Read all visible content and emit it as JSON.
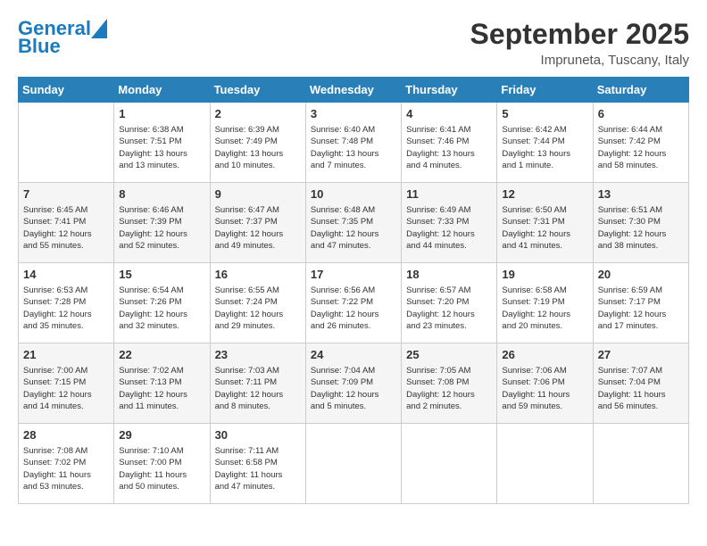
{
  "header": {
    "logo_line1": "General",
    "logo_line2": "Blue",
    "month_title": "September 2025",
    "subtitle": "Impruneta, Tuscany, Italy"
  },
  "days_of_week": [
    "Sunday",
    "Monday",
    "Tuesday",
    "Wednesday",
    "Thursday",
    "Friday",
    "Saturday"
  ],
  "weeks": [
    [
      {
        "day": "",
        "content": ""
      },
      {
        "day": "1",
        "content": "Sunrise: 6:38 AM\nSunset: 7:51 PM\nDaylight: 13 hours\nand 13 minutes."
      },
      {
        "day": "2",
        "content": "Sunrise: 6:39 AM\nSunset: 7:49 PM\nDaylight: 13 hours\nand 10 minutes."
      },
      {
        "day": "3",
        "content": "Sunrise: 6:40 AM\nSunset: 7:48 PM\nDaylight: 13 hours\nand 7 minutes."
      },
      {
        "day": "4",
        "content": "Sunrise: 6:41 AM\nSunset: 7:46 PM\nDaylight: 13 hours\nand 4 minutes."
      },
      {
        "day": "5",
        "content": "Sunrise: 6:42 AM\nSunset: 7:44 PM\nDaylight: 13 hours\nand 1 minute."
      },
      {
        "day": "6",
        "content": "Sunrise: 6:44 AM\nSunset: 7:42 PM\nDaylight: 12 hours\nand 58 minutes."
      }
    ],
    [
      {
        "day": "7",
        "content": "Sunrise: 6:45 AM\nSunset: 7:41 PM\nDaylight: 12 hours\nand 55 minutes."
      },
      {
        "day": "8",
        "content": "Sunrise: 6:46 AM\nSunset: 7:39 PM\nDaylight: 12 hours\nand 52 minutes."
      },
      {
        "day": "9",
        "content": "Sunrise: 6:47 AM\nSunset: 7:37 PM\nDaylight: 12 hours\nand 49 minutes."
      },
      {
        "day": "10",
        "content": "Sunrise: 6:48 AM\nSunset: 7:35 PM\nDaylight: 12 hours\nand 47 minutes."
      },
      {
        "day": "11",
        "content": "Sunrise: 6:49 AM\nSunset: 7:33 PM\nDaylight: 12 hours\nand 44 minutes."
      },
      {
        "day": "12",
        "content": "Sunrise: 6:50 AM\nSunset: 7:31 PM\nDaylight: 12 hours\nand 41 minutes."
      },
      {
        "day": "13",
        "content": "Sunrise: 6:51 AM\nSunset: 7:30 PM\nDaylight: 12 hours\nand 38 minutes."
      }
    ],
    [
      {
        "day": "14",
        "content": "Sunrise: 6:53 AM\nSunset: 7:28 PM\nDaylight: 12 hours\nand 35 minutes."
      },
      {
        "day": "15",
        "content": "Sunrise: 6:54 AM\nSunset: 7:26 PM\nDaylight: 12 hours\nand 32 minutes."
      },
      {
        "day": "16",
        "content": "Sunrise: 6:55 AM\nSunset: 7:24 PM\nDaylight: 12 hours\nand 29 minutes."
      },
      {
        "day": "17",
        "content": "Sunrise: 6:56 AM\nSunset: 7:22 PM\nDaylight: 12 hours\nand 26 minutes."
      },
      {
        "day": "18",
        "content": "Sunrise: 6:57 AM\nSunset: 7:20 PM\nDaylight: 12 hours\nand 23 minutes."
      },
      {
        "day": "19",
        "content": "Sunrise: 6:58 AM\nSunset: 7:19 PM\nDaylight: 12 hours\nand 20 minutes."
      },
      {
        "day": "20",
        "content": "Sunrise: 6:59 AM\nSunset: 7:17 PM\nDaylight: 12 hours\nand 17 minutes."
      }
    ],
    [
      {
        "day": "21",
        "content": "Sunrise: 7:00 AM\nSunset: 7:15 PM\nDaylight: 12 hours\nand 14 minutes."
      },
      {
        "day": "22",
        "content": "Sunrise: 7:02 AM\nSunset: 7:13 PM\nDaylight: 12 hours\nand 11 minutes."
      },
      {
        "day": "23",
        "content": "Sunrise: 7:03 AM\nSunset: 7:11 PM\nDaylight: 12 hours\nand 8 minutes."
      },
      {
        "day": "24",
        "content": "Sunrise: 7:04 AM\nSunset: 7:09 PM\nDaylight: 12 hours\nand 5 minutes."
      },
      {
        "day": "25",
        "content": "Sunrise: 7:05 AM\nSunset: 7:08 PM\nDaylight: 12 hours\nand 2 minutes."
      },
      {
        "day": "26",
        "content": "Sunrise: 7:06 AM\nSunset: 7:06 PM\nDaylight: 11 hours\nand 59 minutes."
      },
      {
        "day": "27",
        "content": "Sunrise: 7:07 AM\nSunset: 7:04 PM\nDaylight: 11 hours\nand 56 minutes."
      }
    ],
    [
      {
        "day": "28",
        "content": "Sunrise: 7:08 AM\nSunset: 7:02 PM\nDaylight: 11 hours\nand 53 minutes."
      },
      {
        "day": "29",
        "content": "Sunrise: 7:10 AM\nSunset: 7:00 PM\nDaylight: 11 hours\nand 50 minutes."
      },
      {
        "day": "30",
        "content": "Sunrise: 7:11 AM\nSunset: 6:58 PM\nDaylight: 11 hours\nand 47 minutes."
      },
      {
        "day": "",
        "content": ""
      },
      {
        "day": "",
        "content": ""
      },
      {
        "day": "",
        "content": ""
      },
      {
        "day": "",
        "content": ""
      }
    ]
  ]
}
